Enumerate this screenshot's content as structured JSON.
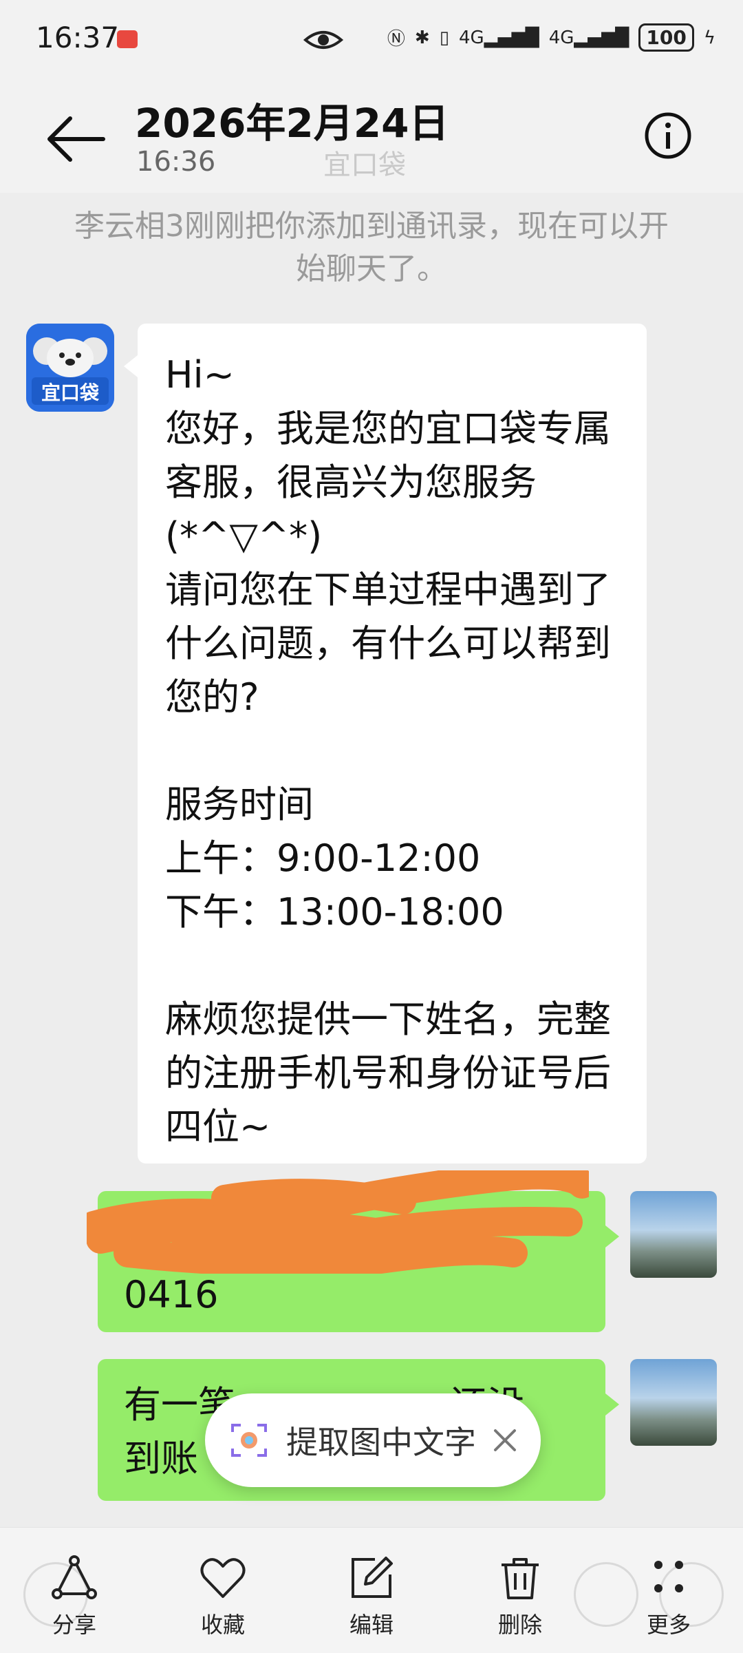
{
  "status_bar": {
    "time": "16:37",
    "network_1": "4G",
    "network_2": "4G",
    "battery": "100"
  },
  "header": {
    "title": "2026年2月24日",
    "subtitle": "16:36",
    "ghost_title": "宜口袋"
  },
  "system_notice": "李云相3刚刚把你添加到通讯录，现在可以开始聊天了。",
  "messages": {
    "agent": {
      "avatar_label": "宜口袋",
      "text": "Hi~\n您好，我是您的宜口袋专属客服，很高兴为您服务(*^▽^*)\n请问您在下单过程中遇到了什么问题，有什么可以帮到您的?\n\n服务时间\n上午：9:00-12:00\n下午：13:00-18:00\n\n麻烦您提供一下姓名，完整的注册手机号和身份证号后四位~"
    },
    "me_1": {
      "visible_text": "0416"
    },
    "me_2": {
      "visible_text_line1": "有一笔",
      "visible_text_line1_end": "还没",
      "visible_text_line2": "到账"
    }
  },
  "ocr_popup": {
    "label": "提取图中文字"
  },
  "action_bar": {
    "share": "分享",
    "favorite": "收藏",
    "edit": "编辑",
    "delete": "删除",
    "more": "更多"
  },
  "colors": {
    "my_bubble": "#95ec69",
    "agent_bubble": "#ffffff",
    "background": "#ededed",
    "redaction": "#f0883a"
  }
}
